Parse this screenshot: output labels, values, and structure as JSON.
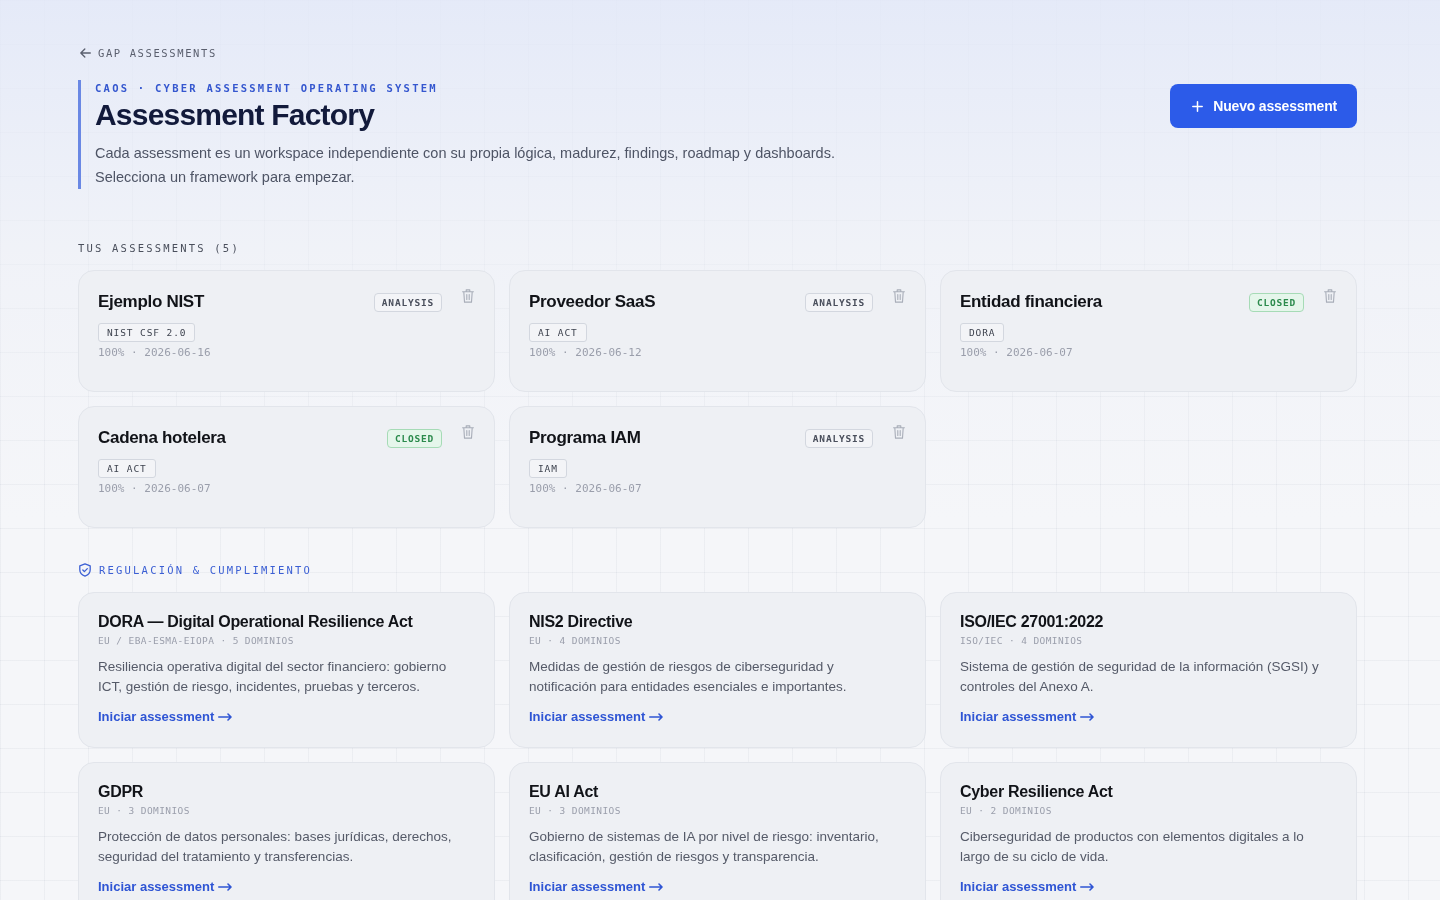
{
  "back_link": "GAP ASSESSMENTS",
  "hero": {
    "eyebrow": "CAOS · CYBER ASSESSMENT OPERATING SYSTEM",
    "title": "Assessment **Factory**",
    "description": "Cada assessment es un workspace independiente con su propia lógica, madurez, findings, roadmap y dashboards. Selecciona un framework para empezar."
  },
  "new_button": "Nuevo assessment",
  "assessments": {
    "heading": "TUS ASSESSMENTS (5)",
    "items": [
      {
        "name": "Ejemplo NIST",
        "status": {
          "kind": "analysis",
          "label": "ANALYSIS"
        },
        "framework": "NIST CSF 2.0",
        "meta": "100% · 2026-06-16"
      },
      {
        "name": "Proveedor SaaS",
        "status": {
          "kind": "analysis",
          "label": "ANALYSIS"
        },
        "framework": "AI ACT",
        "meta": "100% · 2026-06-12"
      },
      {
        "name": "Entidad financiera",
        "status": {
          "kind": "closed",
          "label": "CLOSED"
        },
        "framework": "DORA",
        "meta": "100% · 2026-06-07"
      },
      {
        "name": "Cadena hotelera",
        "status": {
          "kind": "closed",
          "label": "CLOSED"
        },
        "framework": "AI ACT",
        "meta": "100% · 2026-06-07"
      },
      {
        "name": "Programa IAM",
        "status": {
          "kind": "analysis",
          "label": "ANALYSIS"
        },
        "framework": "IAM",
        "meta": "100% · 2026-06-07"
      }
    ]
  },
  "frameworks": {
    "heading": "REGULACIÓN & CUMPLIMIENTO",
    "items": [
      {
        "title": "DORA — Digital Operational Resilience Act",
        "meta": "EU / EBA-ESMA-EIOPA · 5 DOMINIOS",
        "description": "Resiliencia operativa digital del sector financiero: gobierno ICT, gestión de riesgo, incidentes, pruebas y terceros.",
        "link": "Iniciar assessment"
      },
      {
        "title": "NIS2 Directive",
        "meta": "EU · 4 DOMINIOS",
        "description": "Medidas de gestión de riesgos de ciberseguridad y notificación para entidades esenciales e importantes.",
        "link": "Iniciar assessment"
      },
      {
        "title": "ISO/IEC 27001:2022",
        "meta": "ISO/IEC · 4 DOMINIOS",
        "description": "Sistema de gestión de seguridad de la información (SGSI) y controles del Anexo A.",
        "link": "Iniciar assessment"
      },
      {
        "title": "GDPR",
        "meta": "EU · 3 DOMINIOS",
        "description": "Protección de datos personales: bases jurídicas, derechos, seguridad del tratamiento y transferencias.",
        "link": "Iniciar assessment"
      },
      {
        "title": "EU AI Act",
        "meta": "EU · 3 DOMINIOS",
        "description": "Gobierno de sistemas de IA por nivel de riesgo: inventario, clasificación, gestión de riesgos y transparencia.",
        "link": "Iniciar assessment"
      },
      {
        "title": "Cyber Resilience Act",
        "meta": "EU · 2 DOMINIOS",
        "description": "Ciberseguridad de productos con elementos digitales a lo largo de su ciclo de vida.",
        "link": "Iniciar assessment"
      }
    ]
  }
}
